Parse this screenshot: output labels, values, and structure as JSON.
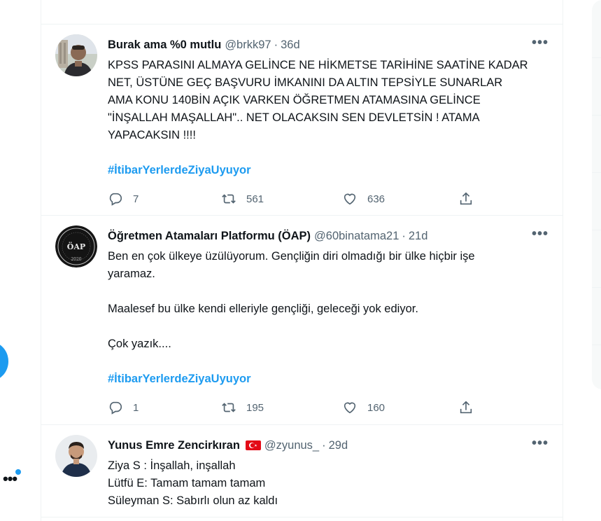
{
  "colors": {
    "accent": "#1d9bf0",
    "text": "#0f1419",
    "secondary": "#536471",
    "border": "#eff3f4"
  },
  "nav": {
    "more_icon": "more-horizontal-icon"
  },
  "tweets": [
    {
      "name": "Burak ama %0 mutlu",
      "handle": "@brkk97",
      "separator": "·",
      "time": "36d",
      "lines": [
        "KPSS PARASINI ALMAYA GELİNCE NE HİKMETSE TARİHİNE SAATİNE KADAR",
        "NET, ÜSTÜNE GEÇ BAŞVURU İMKANINI DA ALTIN TEPSİYLE SUNARLAR",
        "AMA KONU 140BİN AÇIK VARKEN ÖĞRETMEN ATAMASINA GELİNCE",
        "\"İNŞALLAH MAŞALLAH\".. NET OLACAKSIN SEN DEVLETSİN ! ATAMA",
        "YAPACAKSIN !!!!"
      ],
      "hashtag": "#İtibarYerlerdeZiyaUyuyor",
      "replies": "7",
      "retweets": "561",
      "likes": "636"
    },
    {
      "name": "Öğretmen Atamaları Platformu (ÖAP)",
      "handle": "@60binatama21",
      "separator": "·",
      "time": "21d",
      "avatar_text": "ÖAP",
      "avatar_year": "2020",
      "line1": "Ben en çok ülkeye üzülüyorum. Gençliğin diri olmadığı bir ülke hiçbir işe",
      "line2": "yaramaz.",
      "line3": "Maalesef bu ülke kendi elleriyle gençliği, geleceği yok ediyor.",
      "line4": "Çok yazık....",
      "hashtag": "#İtibarYerlerdeZiyaUyuyor",
      "replies": "1",
      "retweets": "195",
      "likes": "160"
    },
    {
      "name": "Yunus Emre Zencirkıran",
      "handle": "@zyunus_",
      "separator": "·",
      "time": "29d",
      "lines": [
        "Ziya S : İnşallah, inşallah",
        "Lütfü E: Tamam tamam tamam",
        "Süleyman S: Sabırlı olun az kaldı"
      ]
    }
  ]
}
